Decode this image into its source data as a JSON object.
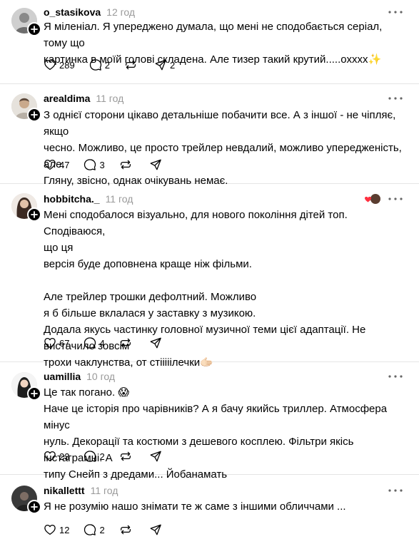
{
  "posts": [
    {
      "username": "o_stasikova",
      "time": "12 год",
      "lines": [
        "Я міленіал. Я упереджено думала, що мені не сподобається серіал, тому що",
        "картинка в моїй голові складена. Але тизер такий крутий.....охххх✨"
      ],
      "likes": "289",
      "replies": "2",
      "reposts": "",
      "shares": "2"
    },
    {
      "username": "arealdima",
      "time": "11 год",
      "lines": [
        "З однієї сторони цікаво детальніше побачити все. А з іншої - не чіпляє, якщо",
        "чесно. Можливо, це просто трейлер невдалий, можливо упередженість, але.",
        "Гляну, звісно, однак очікувань немає."
      ],
      "likes": "47",
      "replies": "3",
      "reposts": "",
      "shares": ""
    },
    {
      "username": "hobbitcha._",
      "time": "11 год",
      "lines": [
        "Мені сподобалося візуально, для нового покоління дітей топ. Сподіваюся,",
        "що ця",
        "версія буде доповнена краще ніж фільми.",
        "",
        "Але трейлер трошки дефолтний. Можливо",
        "я б більше вклалася у заставку з музикою.",
        "Додала якусь частинку головної музичної теми цієї адаптації. Не",
        "вистачило зовсім",
        "трохи чаклунства, от стііііілечки🫱🏻"
      ],
      "likes": "67",
      "replies": "4",
      "reposts": "",
      "shares": ""
    },
    {
      "username": "uamillia",
      "time": "10 год",
      "lines": [
        "Це так погано. 😱",
        "Наче це історія про чарівників? А я бачу якийсь триллер. Атмосфера мінус",
        "нуль. Декорації та костюми з дешевого косплею. Фільтри якісь інстаграмні. А",
        "типу Снейп з дредами... Йобанамать"
      ],
      "likes": "23",
      "replies": "2",
      "reposts": "",
      "shares": ""
    },
    {
      "username": "nikallettt",
      "time": "11 год",
      "lines": [
        "Я не розумію нашо знімати те ж саме з іншими обличчами ..."
      ],
      "likes": "12",
      "replies": "2",
      "reposts": "",
      "shares": ""
    }
  ],
  "icons": {
    "like": "heart-icon",
    "reply": "comment-icon",
    "repost": "repost-icon",
    "share": "send-icon",
    "more": "more-icon",
    "follow": "plus-icon"
  },
  "colors": {
    "text": "#000000",
    "muted": "#999999",
    "divider": "#e5e5e5"
  }
}
